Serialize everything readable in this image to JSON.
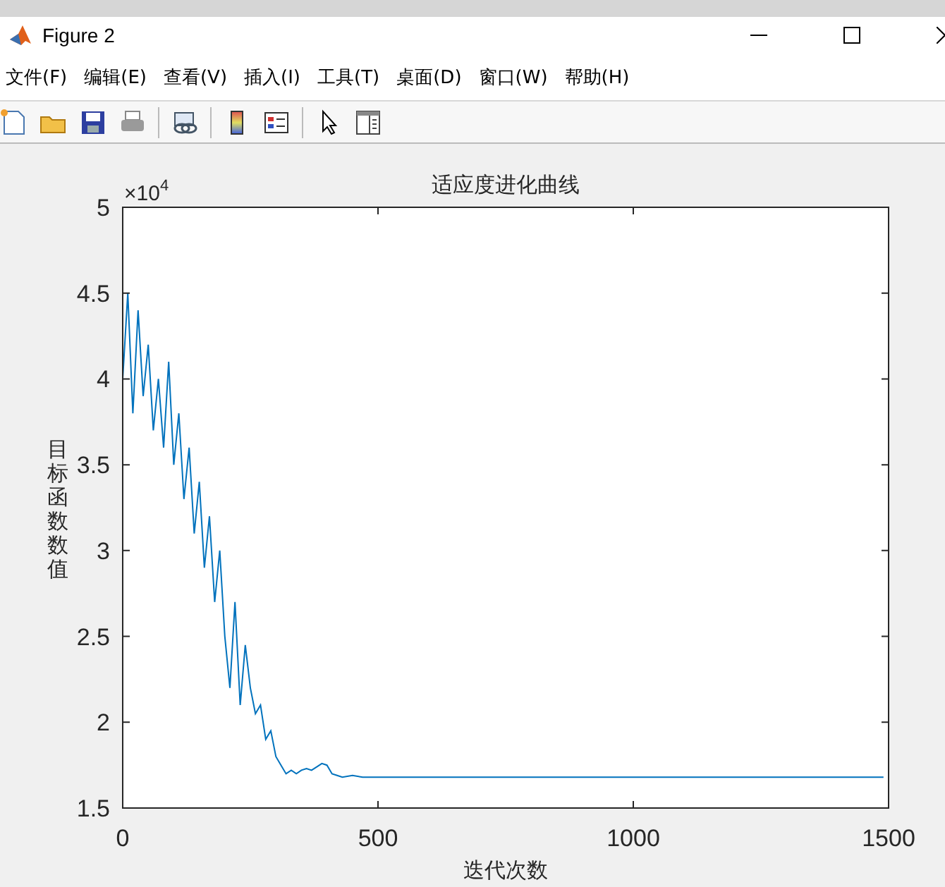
{
  "window": {
    "title": "Figure 2"
  },
  "menu": [
    "文件(F)",
    "编辑(E)",
    "查看(V)",
    "插入(I)",
    "工具(T)",
    "桌面(D)",
    "窗口(W)",
    "帮助(H)"
  ],
  "figure": {
    "y_multiplier": "×10$^{4}$",
    "chart_data": {
      "type": "line",
      "title": "适应度进化曲线",
      "xlabel": "迭代次数",
      "ylabel": "目标函数数值",
      "x": [
        0,
        10,
        20,
        30,
        40,
        50,
        60,
        70,
        80,
        90,
        100,
        110,
        120,
        130,
        140,
        150,
        160,
        170,
        180,
        190,
        200,
        210,
        220,
        230,
        240,
        250,
        260,
        270,
        280,
        290,
        300,
        310,
        320,
        330,
        340,
        350,
        360,
        370,
        380,
        390,
        400,
        410,
        420,
        430,
        450,
        470,
        500,
        550,
        1490
      ],
      "series": [
        {
          "color": "#0072bd",
          "values": [
            4.0,
            4.5,
            3.8,
            4.4,
            3.9,
            4.2,
            3.7,
            4.0,
            3.6,
            4.1,
            3.5,
            3.8,
            3.3,
            3.6,
            3.1,
            3.4,
            2.9,
            3.2,
            2.7,
            3.0,
            2.5,
            2.2,
            2.7,
            2.1,
            2.45,
            2.2,
            2.05,
            2.1,
            1.9,
            1.95,
            1.8,
            1.75,
            1.7,
            1.72,
            1.7,
            1.72,
            1.73,
            1.72,
            1.74,
            1.76,
            1.75,
            1.7,
            1.69,
            1.68,
            1.69,
            1.68,
            1.68,
            1.68,
            1.68
          ]
        }
      ],
      "xlim": [
        0,
        1500
      ],
      "ylim": [
        1.5,
        5
      ],
      "xticks": [
        0,
        500,
        1000,
        1500
      ],
      "yticks": [
        1.5,
        2,
        2.5,
        3,
        3.5,
        4,
        4.5,
        5
      ]
    }
  }
}
